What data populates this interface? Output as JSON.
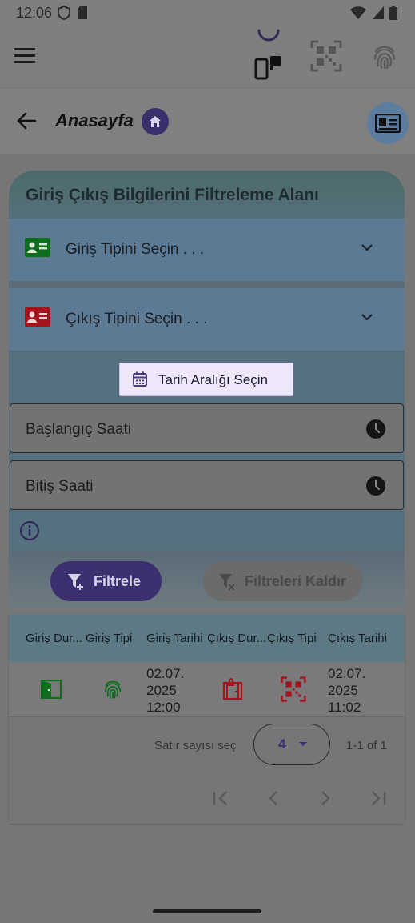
{
  "status_bar": {
    "time": "12:06"
  },
  "header": {
    "title": "Anasayfa"
  },
  "filter": {
    "title": "Giriş Çıkış Bilgilerini Filtreleme Alanı",
    "entry_type_placeholder": "Giriş Tipini Seçin . . .",
    "exit_type_placeholder": "Çıkış Tipini Seçin . . .",
    "date_range_label": "Tarih Aralığı Seçin",
    "start_time_label": "Başlangıç Saati",
    "end_time_label": "Bitiş Saati",
    "apply_label": "Filtrele",
    "clear_label": "Filtreleri Kaldır"
  },
  "table": {
    "columns": [
      "Giriş Dur...",
      "Giriş Tipi",
      "Giriş Tarihi",
      "Çıkış Dur...",
      "Çıkış Tipi",
      "Çıkış Tarihi"
    ],
    "rows": [
      {
        "entry_status_icon": "door-open-icon",
        "entry_type_icon": "fingerprint-icon",
        "entry_date": [
          "02.07.",
          "2025",
          "12:00"
        ],
        "exit_status_icon": "door-locked-icon",
        "exit_type_icon": "qr-code-icon",
        "exit_date": [
          "02.07.",
          "2025",
          "11:02"
        ]
      }
    ],
    "rows_per_page_label": "Satır sayısı seç",
    "rows_per_page_value": "4",
    "range_label": "1-1 of 1"
  },
  "colors": {
    "accent": "#3c2f6f",
    "entry_green": "#0e6e1e",
    "exit_red": "#a4141c"
  }
}
